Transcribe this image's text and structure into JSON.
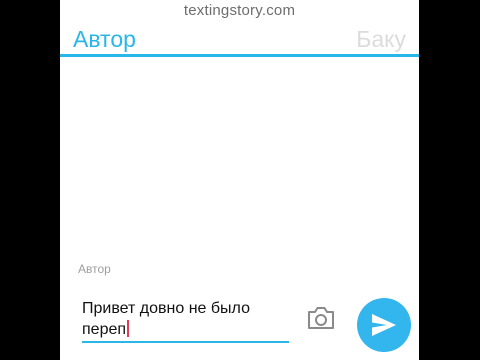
{
  "watermark": "textingstory.com",
  "tabs": {
    "left": "Автор",
    "right": "Баку"
  },
  "composer": {
    "sender_label": "Автор",
    "text": "Привет довно не было переп"
  },
  "icons": {
    "camera": "camera-icon",
    "send": "send-icon"
  },
  "colors": {
    "accent": "#29b6e8",
    "send_button": "#33b5ee",
    "caret": "#e53a57",
    "inactive_tab": "#dcdcdc"
  }
}
